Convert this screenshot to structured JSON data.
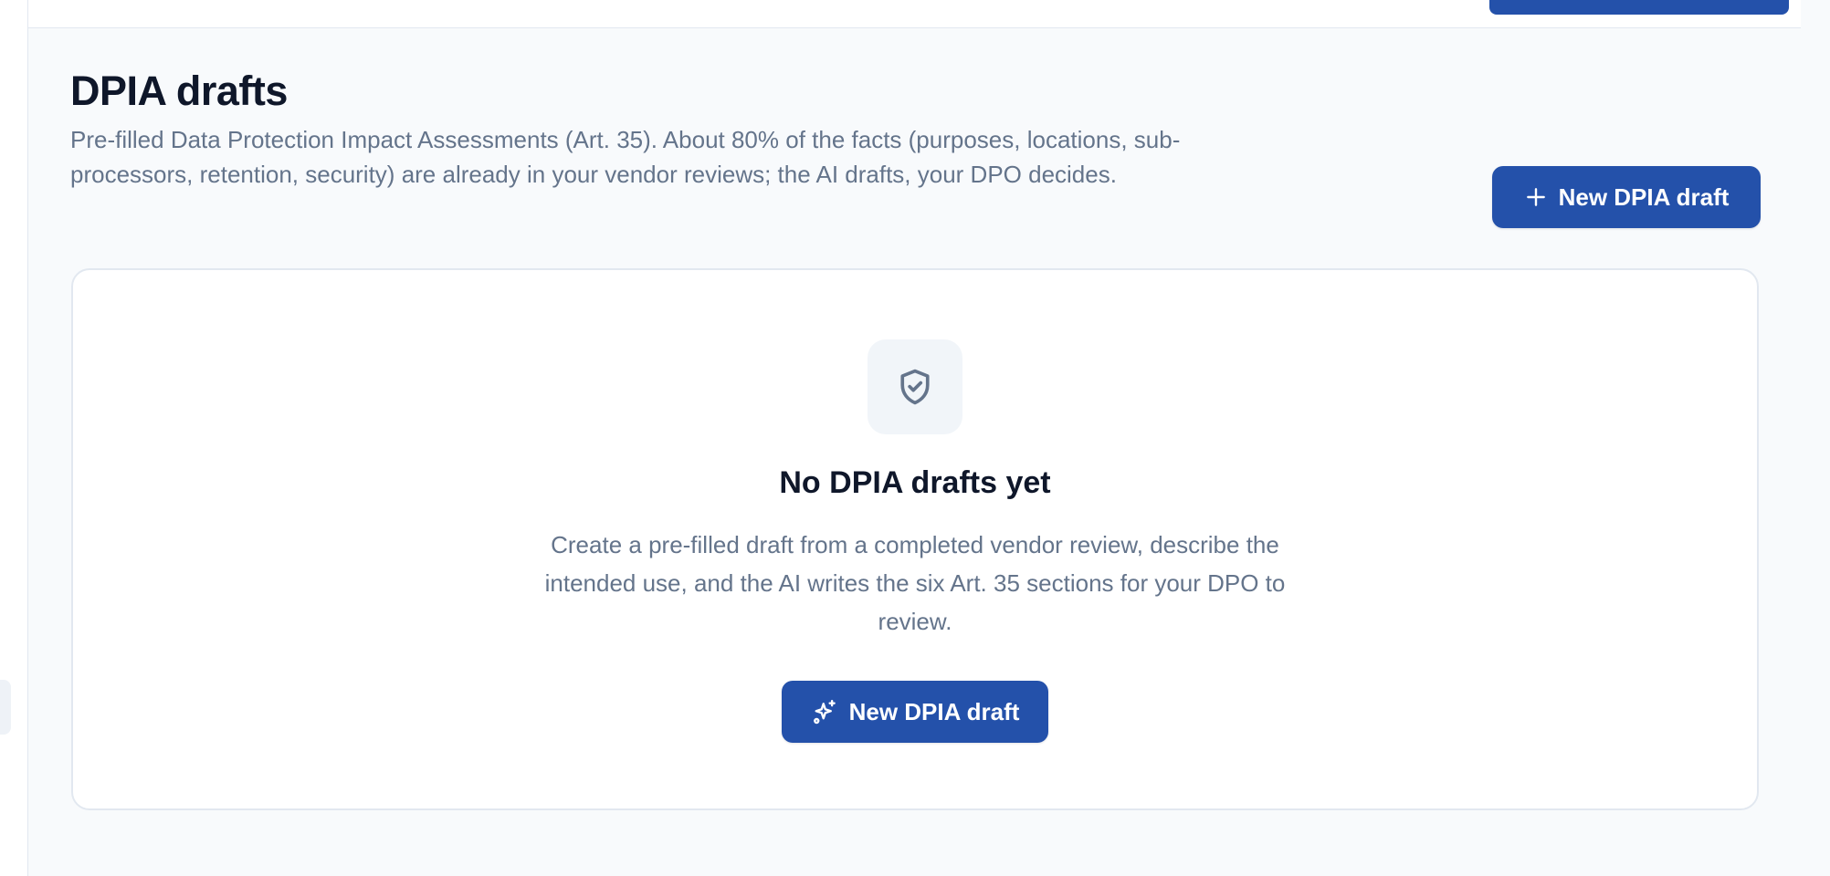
{
  "page": {
    "title": "DPIA drafts",
    "description": "Pre-filled Data Protection Impact Assessments (Art. 35). About 80% of the facts (purposes, locations, sub-processors, retention, security) are already in your vendor reviews; the AI drafts, your DPO decides."
  },
  "header_actions": {
    "new_draft_label": "New DPIA draft",
    "new_draft_icon": "plus-icon"
  },
  "empty_state": {
    "icon": "shield-check-icon",
    "title": "No DPIA drafts yet",
    "description": "Create a pre-filled draft from a completed vendor review, describe the intended use, and the AI writes the six Art. 35 sections for your DPO to review.",
    "button_label": "New DPIA draft",
    "button_icon": "sparkles-icon"
  },
  "colors": {
    "primary": "#2451aa",
    "title": "#0f172a",
    "muted_text": "#64748b",
    "background": "#f8fafc",
    "card_border": "#e2e8f0",
    "icon_tile": "#f1f5f9"
  }
}
